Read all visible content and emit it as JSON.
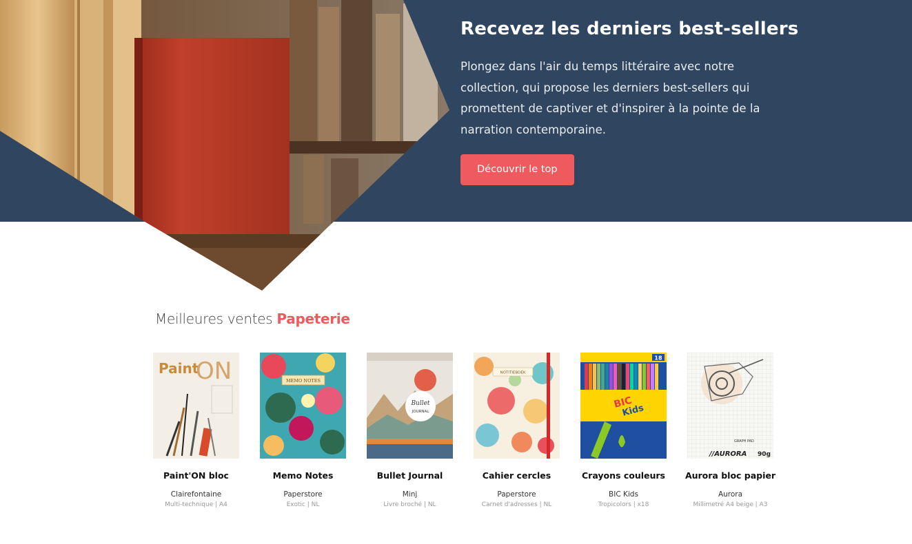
{
  "hero": {
    "title": "Recevez les derniers best-sellers",
    "text": "Plongez dans l'air du temps littéraire avec notre collection, qui propose les derniers best-sellers qui promettent de captiver et d'inspirer à la pointe de la narration contemporaine.",
    "button_label": "Découvrir le top",
    "background_color": "#2f4560",
    "accent_color": "#ee5a5d"
  },
  "section": {
    "title_prefix": "Meilleures ventes ",
    "title_highlight": "Papeterie"
  },
  "products": [
    {
      "name": "Paint'ON bloc",
      "brand": "Clairefontaine",
      "meta": "Multi-technique | A4",
      "cover_text": "Paint ON"
    },
    {
      "name": "Memo Notes",
      "brand": "Paperstore",
      "meta": "Exotic | NL",
      "cover_text": "MEMO NOTES"
    },
    {
      "name": "Bullet Journal",
      "brand": "Minj",
      "meta": "Livre broché | NL",
      "cover_text": "Bullet JOURNAL"
    },
    {
      "name": "Cahier cercles",
      "brand": "Paperstore",
      "meta": "Carnet d'adresses | NL",
      "cover_text": "NOTITIEBOEK"
    },
    {
      "name": "Crayons couleurs",
      "brand": "BIC Kids",
      "meta": "Tropicolors | x18",
      "cover_text": "BIC Kids 18"
    },
    {
      "name": "Aurora bloc papier",
      "brand": "Aurora",
      "meta": "Millimetré A4 beige | A3",
      "cover_text": "AURORA 90g GRAPH PAD"
    }
  ]
}
